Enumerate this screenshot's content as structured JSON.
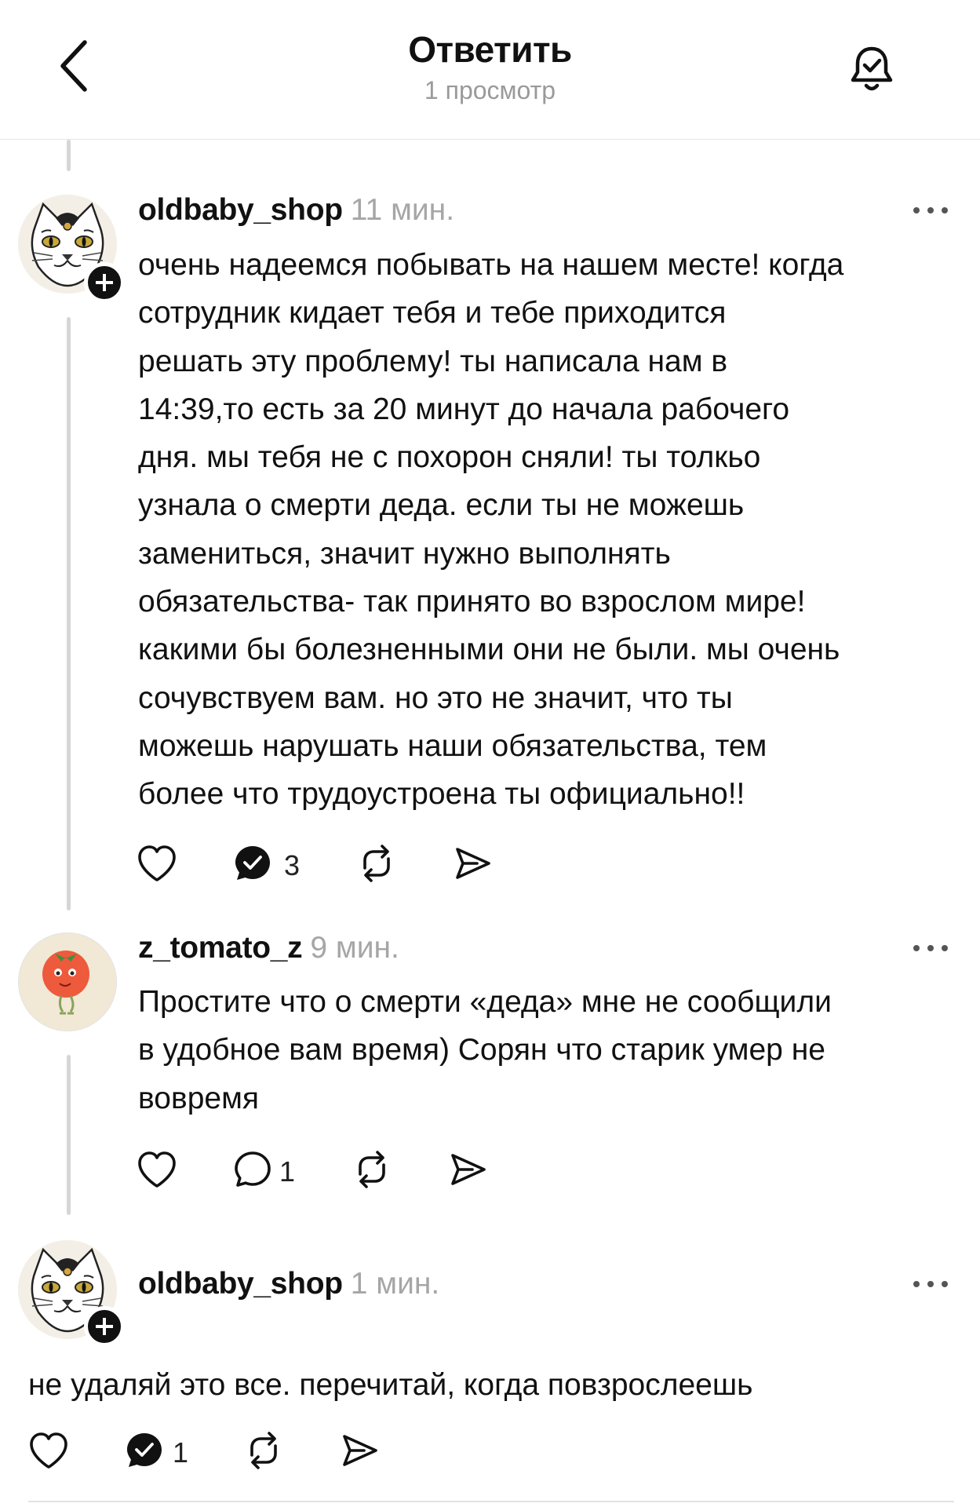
{
  "header": {
    "title": "Ответить",
    "subtitle": "1 просмотр",
    "back_icon": "chevron-left-icon",
    "bell_icon": "bell-check-icon"
  },
  "posts": [
    {
      "username": "oldbaby_shop",
      "time": "11 мин.",
      "avatar": "cat-avatar",
      "text": "очень надеемся побывать на нашем месте! когда\nсотрудник кидает тебя и тебе приходится\nрешать эту проблему! ты написала нам в\n14:39,то есть за 20 минут до начала рабочего\nдня. мы тебя не с похорон сняли! ты толкьо\nузнала о смерти деда. если ты не можешь\nзамениться, значит нужно выполнять\nобязательства- так принято во взрослом мире!\nкакими бы болезненными они не были. мы очень\nсочувствуем вам. но это не значит, что ты\nможешь нарушать наши обязательства, тем\nболее что трудоустроена ты официально!!",
      "reply_count": "3"
    },
    {
      "username": "z_tomato_z",
      "time": "9 мин.",
      "avatar": "tomato-avatar",
      "text": "Простите что о смерти «деда» мне не сообщили\nв удобное вам время) Сорян что старик умер не\nвовремя",
      "reply_count": "1"
    },
    {
      "username": "oldbaby_shop",
      "time": "1 мин.",
      "avatar": "cat-avatar",
      "text": "не удаляй это все. перечитай, когда повзрослеешь",
      "reply_count": "1"
    }
  ],
  "colors": {
    "text": "#111111",
    "muted": "#a6a6a6",
    "thread_line": "#d6d6d6",
    "divider": "#e3e3e3"
  }
}
